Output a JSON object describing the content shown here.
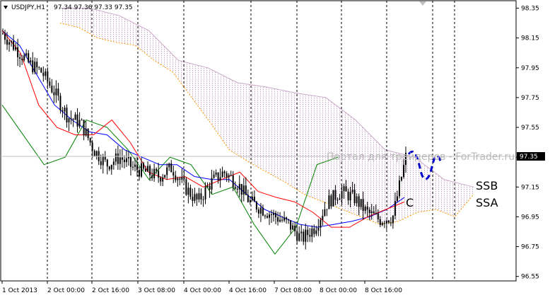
{
  "header": {
    "symbol": "USDJPY,H1",
    "ohlc": "97.34 97.36 97.33 97.35"
  },
  "watermark": "Портал для трейдеров - ForTrader.ru",
  "annotations": {
    "c": "C",
    "ssb": "SSB",
    "ssa": "SSA"
  },
  "price_axis": {
    "labels": [
      "98.35",
      "98.15",
      "97.95",
      "97.75",
      "97.55",
      "97.35",
      "97.15",
      "96.95",
      "96.75",
      "96.55"
    ],
    "current_price": "97.35"
  },
  "time_axis": {
    "labels": [
      "1 Oct 2013",
      "2 Oct 00:00",
      "2 Oct 16:00",
      "3 Oct 08:00",
      "4 Oct 00:00",
      "4 Oct 16:00",
      "7 Oct 08:00",
      "8 Oct 00:00",
      "8 Oct 16:00"
    ]
  },
  "colors": {
    "candles": "#000000",
    "tenkan": "#ff0000",
    "kijun": "#0000ff",
    "chikou": "#008000",
    "ssa": "#ff9900",
    "cloud": "#c8a8c8",
    "forecast": "#0000cc"
  },
  "chart_data": {
    "type": "candlestick",
    "title": "USDJPY,H1",
    "ylim": [
      96.52,
      98.4
    ],
    "x": [
      "1 Oct 2013",
      "2 Oct 00:00",
      "2 Oct 16:00",
      "3 Oct 08:00",
      "4 Oct 00:00",
      "4 Oct 16:00",
      "7 Oct 08:00",
      "8 Oct 00:00",
      "8 Oct 16:00"
    ],
    "close": [
      98.18,
      98.08,
      97.98,
      97.92,
      97.78,
      97.62,
      97.58,
      97.4,
      97.3,
      97.35,
      97.28,
      97.25,
      97.22,
      97.28,
      97.15,
      97.05,
      97.18,
      97.25,
      97.18,
      97.05,
      97.0,
      96.95,
      96.9,
      96.8,
      96.88,
      97.05,
      97.12,
      97.08,
      96.98,
      96.93,
      96.95,
      97.35
    ],
    "series": [
      {
        "name": "Tenkan-sen",
        "values": [
          98.2,
          98.05,
          97.7,
          97.55,
          97.5,
          97.5,
          97.6,
          97.45,
          97.25,
          97.2,
          97.22,
          97.15,
          97.2,
          97.25,
          97.12,
          97.08,
          97.05,
          96.98,
          96.88,
          96.88,
          96.95,
          97.0,
          97.05
        ]
      },
      {
        "name": "Kijun-sen",
        "values": [
          98.2,
          98.1,
          97.9,
          97.7,
          97.6,
          97.52,
          97.5,
          97.4,
          97.35,
          97.3,
          97.3,
          97.22,
          97.2,
          97.2,
          97.1,
          97.0,
          96.95,
          96.9,
          96.88,
          96.9,
          96.92,
          96.95,
          97.0,
          97.08
        ]
      },
      {
        "name": "Chikou Span",
        "values": [
          97.7,
          97.5,
          97.3,
          97.35,
          97.6,
          97.55,
          97.4,
          97.2,
          97.35,
          97.3,
          97.1,
          97.15,
          96.9,
          96.7,
          96.88,
          97.3,
          97.35
        ]
      },
      {
        "name": "Senkou Span A",
        "values": [
          98.25,
          98.22,
          98.15,
          98.12,
          98.1,
          98.0,
          97.92,
          97.75,
          97.58,
          97.4,
          97.32,
          97.25,
          97.18,
          97.1,
          97.05,
          97.0,
          96.95,
          96.9,
          96.92,
          96.98,
          97.0,
          96.95,
          97.1
        ]
      },
      {
        "name": "Senkou Span B",
        "values": [
          98.35,
          98.35,
          98.3,
          98.2,
          98.0,
          97.95,
          97.85,
          97.82,
          97.78,
          97.75,
          97.6,
          97.4,
          97.35,
          97.2,
          97.15
        ]
      }
    ]
  }
}
